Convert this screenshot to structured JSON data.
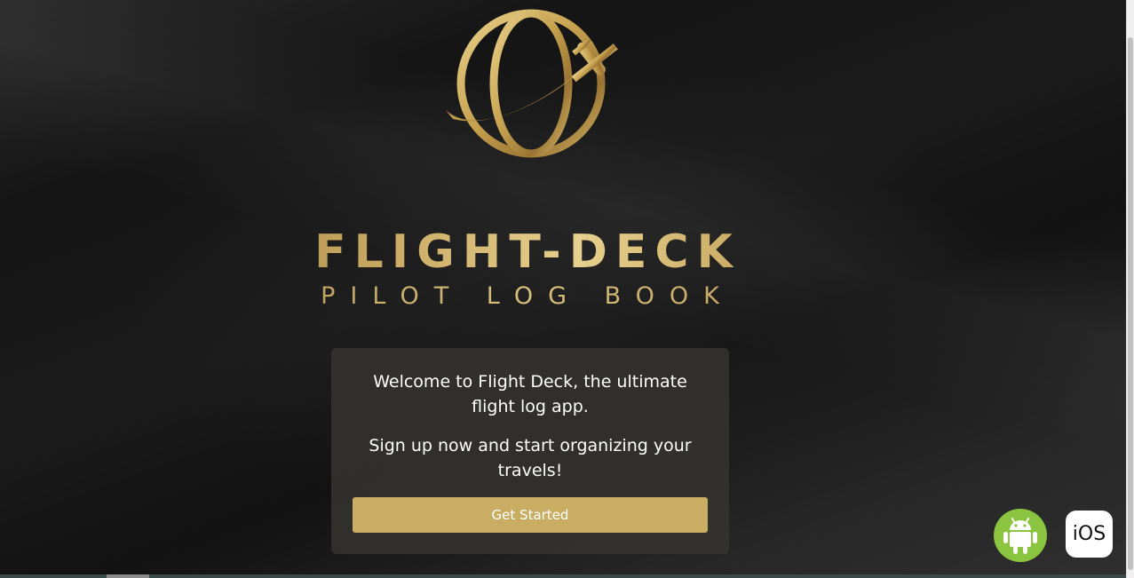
{
  "brand": {
    "title": "FLIGHT-DECK",
    "subtitle": "PILOT LOG BOOK",
    "accent_color": "#c8ad62"
  },
  "welcome_card": {
    "line1": "Welcome to Flight Deck, the ultimate flight log app.",
    "line2": "Sign up now and start organizing your travels!",
    "button_label": "Get Started"
  },
  "app_badges": {
    "android": {
      "icon": "android-icon",
      "color": "#8bc43f"
    },
    "ios": {
      "label": "iOS"
    }
  }
}
